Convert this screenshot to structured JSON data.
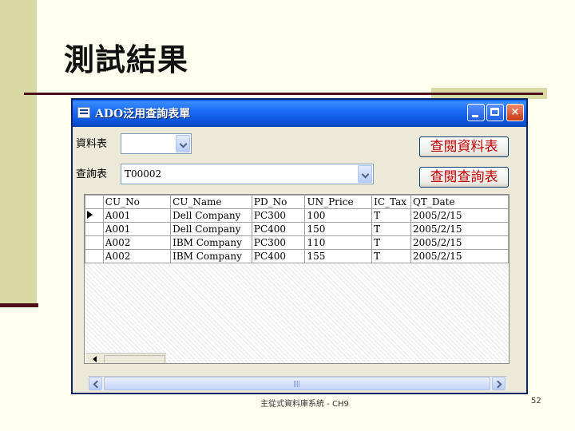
{
  "slide": {
    "title": "測試結果",
    "footer_center": "主從式資料庫系統 - CH9",
    "page_number": "52"
  },
  "window": {
    "title": "ADO泛用查詢表單",
    "controls": {
      "minimize": "minimize-icon",
      "maximize": "maximize-icon",
      "close": "×"
    }
  },
  "form": {
    "table_label": "資料表",
    "table_value": "",
    "query_label": "查詢表",
    "query_value": "T00002",
    "browse_table_button": "查閱資料表",
    "browse_query_button": "查閱查詢表"
  },
  "grid": {
    "columns": [
      "CU_No",
      "CU_Name",
      "PD_No",
      "UN_Price",
      "IC_Tax",
      "QT_Date"
    ],
    "rows": [
      [
        "A001",
        "Dell Company",
        "PC300",
        "100",
        "T",
        "2005/2/15"
      ],
      [
        "A001",
        "Dell Company",
        "PC400",
        "150",
        "T",
        "2005/2/15"
      ],
      [
        "A002",
        "IBM Company",
        "PC300",
        "110",
        "T",
        "2005/2/15"
      ],
      [
        "A002",
        "IBM Company",
        "PC400",
        "155",
        "T",
        "2005/2/15"
      ]
    ],
    "current_row": 0
  }
}
